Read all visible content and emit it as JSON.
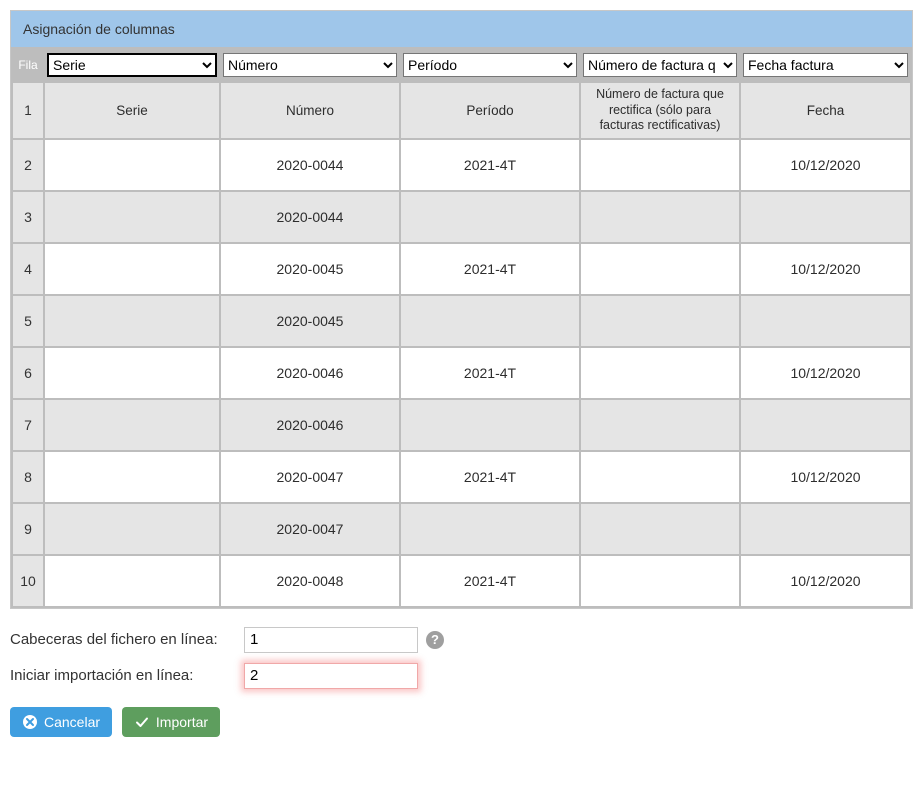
{
  "panel": {
    "title": "Asignación de columnas"
  },
  "headers": {
    "fila": "Fila",
    "serie": "Serie",
    "numero": "Número",
    "periodo": "Período",
    "rectifica": "Número de factura q",
    "fecha": "Fecha factura"
  },
  "rows": [
    {
      "n": "1",
      "serie": "Serie",
      "numero": "Número",
      "periodo": "Período",
      "rect": "Número de factura que rectifica (sólo para facturas rectificativas)",
      "fecha": "Fecha"
    },
    {
      "n": "2",
      "serie": "",
      "numero": "2020-0044",
      "periodo": "2021-4T",
      "rect": "",
      "fecha": "10/12/2020"
    },
    {
      "n": "3",
      "serie": "",
      "numero": "2020-0044",
      "periodo": "",
      "rect": "",
      "fecha": ""
    },
    {
      "n": "4",
      "serie": "",
      "numero": "2020-0045",
      "periodo": "2021-4T",
      "rect": "",
      "fecha": "10/12/2020"
    },
    {
      "n": "5",
      "serie": "",
      "numero": "2020-0045",
      "periodo": "",
      "rect": "",
      "fecha": ""
    },
    {
      "n": "6",
      "serie": "",
      "numero": "2020-0046",
      "periodo": "2021-4T",
      "rect": "",
      "fecha": "10/12/2020"
    },
    {
      "n": "7",
      "serie": "",
      "numero": "2020-0046",
      "periodo": "",
      "rect": "",
      "fecha": ""
    },
    {
      "n": "8",
      "serie": "",
      "numero": "2020-0047",
      "periodo": "2021-4T",
      "rect": "",
      "fecha": "10/12/2020"
    },
    {
      "n": "9",
      "serie": "",
      "numero": "2020-0047",
      "periodo": "",
      "rect": "",
      "fecha": ""
    },
    {
      "n": "10",
      "serie": "",
      "numero": "2020-0048",
      "periodo": "2021-4T",
      "rect": "",
      "fecha": "10/12/2020"
    }
  ],
  "controls": {
    "header_line_label": "Cabeceras del fichero en línea:",
    "header_line_value": "1",
    "start_line_label": "Iniciar importación en línea:",
    "start_line_value": "2",
    "help_glyph": "?"
  },
  "buttons": {
    "cancel": "Cancelar",
    "import": "Importar"
  }
}
